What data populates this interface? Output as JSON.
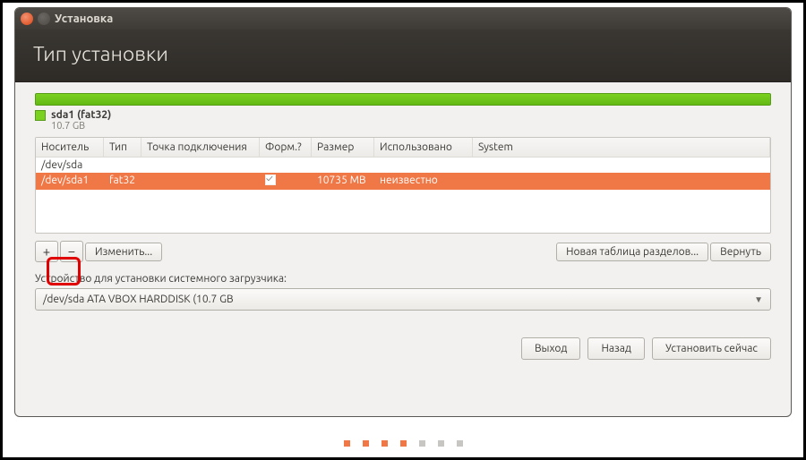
{
  "window": {
    "title": "Установка"
  },
  "header": {
    "title": "Тип установки"
  },
  "partition_bar": {
    "legend_label": "sda1 (fat32)",
    "legend_size": "10.7 GB"
  },
  "table": {
    "headers": {
      "device": "Носитель",
      "type": "Тип",
      "mount": "Точка подключения",
      "format": "Форм.?",
      "size": "Размер",
      "used": "Использовано",
      "system": "System"
    },
    "group_row": {
      "device": "/dev/sda"
    },
    "selected_row": {
      "device": "/dev/sda1",
      "type": "fat32",
      "mount": "",
      "format_checked": true,
      "size": "10735 MB",
      "used": "неизвестно",
      "system": ""
    }
  },
  "toolbar": {
    "add": "+",
    "remove": "−",
    "change": "Изменить...",
    "new_table": "Новая таблица разделов...",
    "revert": "Вернуть"
  },
  "bootloader": {
    "label": "Устройство для установки системного загрузчика:",
    "value": "/dev/sda   ATA VBOX HARDDISK (10.7 GB"
  },
  "footer": {
    "quit": "Выход",
    "back": "Назад",
    "install": "Установить сейчас"
  },
  "pager": {
    "total": 7,
    "active": [
      0,
      1,
      2,
      3
    ]
  }
}
